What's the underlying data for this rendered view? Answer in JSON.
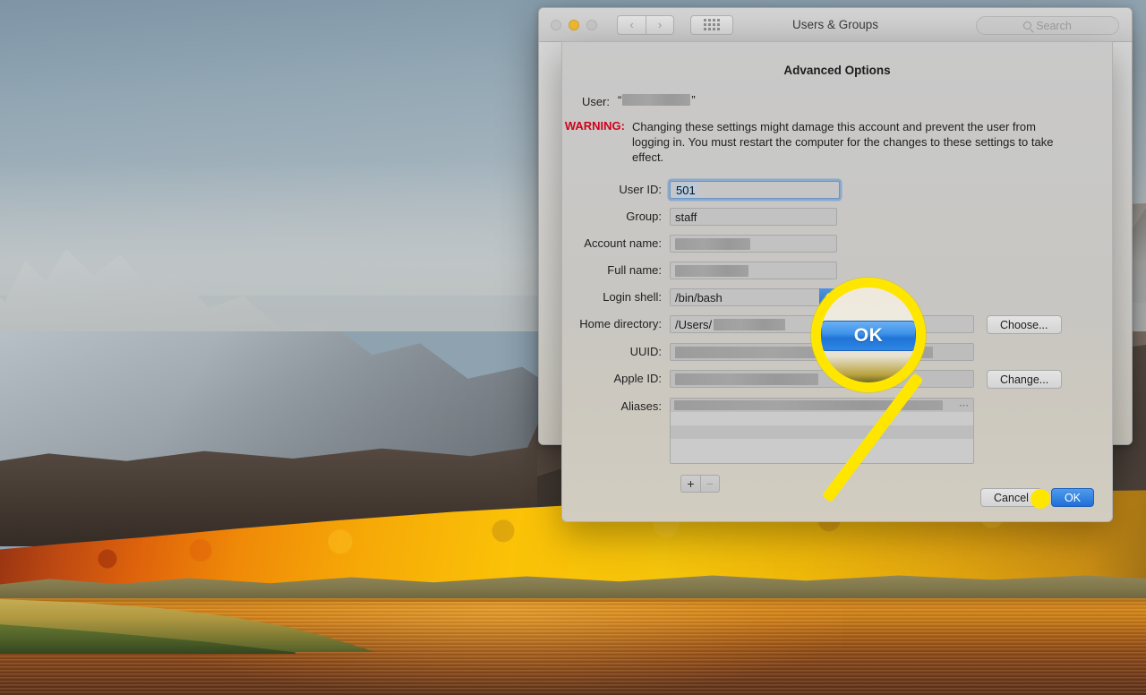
{
  "desktop": {
    "wallpaper_name": "macos-high-sierra-mountain-lake"
  },
  "window": {
    "title": "Users & Groups",
    "traffic_lights": [
      {
        "name": "close",
        "color": "#c4c4c4",
        "label": "Close"
      },
      {
        "name": "minimize",
        "color": "#ecb732",
        "label": "Minimize"
      },
      {
        "name": "maximize",
        "color": "#c4c4c4",
        "label": "Zoom"
      }
    ],
    "nav": {
      "back_label": "‹",
      "forward_label": "›",
      "grid_label": "Show All"
    },
    "search": {
      "placeholder": "Search",
      "value": "",
      "icon": "search-icon"
    }
  },
  "sheet": {
    "title": "Advanced Options",
    "user": {
      "label": "User:",
      "open_quote": "“",
      "close_quote": "”",
      "value": ""
    },
    "warning": {
      "label": "WARNING:",
      "color": "#d0021b",
      "text": "Changing these settings might damage this account and prevent the user from logging in. You must restart the computer for the changes to these settings to take effect."
    },
    "fields": [
      {
        "name": "user-id",
        "label": "User ID:",
        "value": "501",
        "focused": true,
        "selected": true,
        "redacted": false
      },
      {
        "name": "group",
        "label": "Group:",
        "value": "staff",
        "focused": false,
        "selected": false,
        "redacted": false
      },
      {
        "name": "account-name",
        "label": "Account name:",
        "value": "",
        "focused": false,
        "selected": false,
        "redacted": true
      },
      {
        "name": "full-name",
        "label": "Full name:",
        "value": "",
        "focused": false,
        "selected": false,
        "redacted": true
      },
      {
        "name": "login-shell",
        "label": "Login shell:",
        "value": "/bin/bash",
        "focused": false,
        "selected": false,
        "redacted": false
      },
      {
        "name": "home-directory",
        "label": "Home directory:",
        "value": "/Users/",
        "focused": false,
        "selected": false,
        "redacted": true
      },
      {
        "name": "uuid",
        "label": "UUID:",
        "value": "",
        "focused": false,
        "selected": false,
        "redacted": true
      },
      {
        "name": "apple-id",
        "label": "Apple ID:",
        "value": "",
        "focused": false,
        "selected": false,
        "redacted": true
      }
    ],
    "aliases": {
      "label": "Aliases:",
      "rows": [
        "",
        "",
        "",
        "",
        ""
      ],
      "overflow_glyph": "⋯",
      "add_label": "+",
      "remove_label": "−"
    },
    "row_buttons": {
      "choose_label": "Choose...",
      "change_label": "Change..."
    },
    "actions": {
      "cancel_label": "Cancel",
      "ok_label": "OK",
      "default_button": "OK",
      "accent_color": "#1f6fd6"
    }
  },
  "callout": {
    "magnifier_label": "OK",
    "highlight_color": "#ffe600",
    "target": "ok-button"
  }
}
